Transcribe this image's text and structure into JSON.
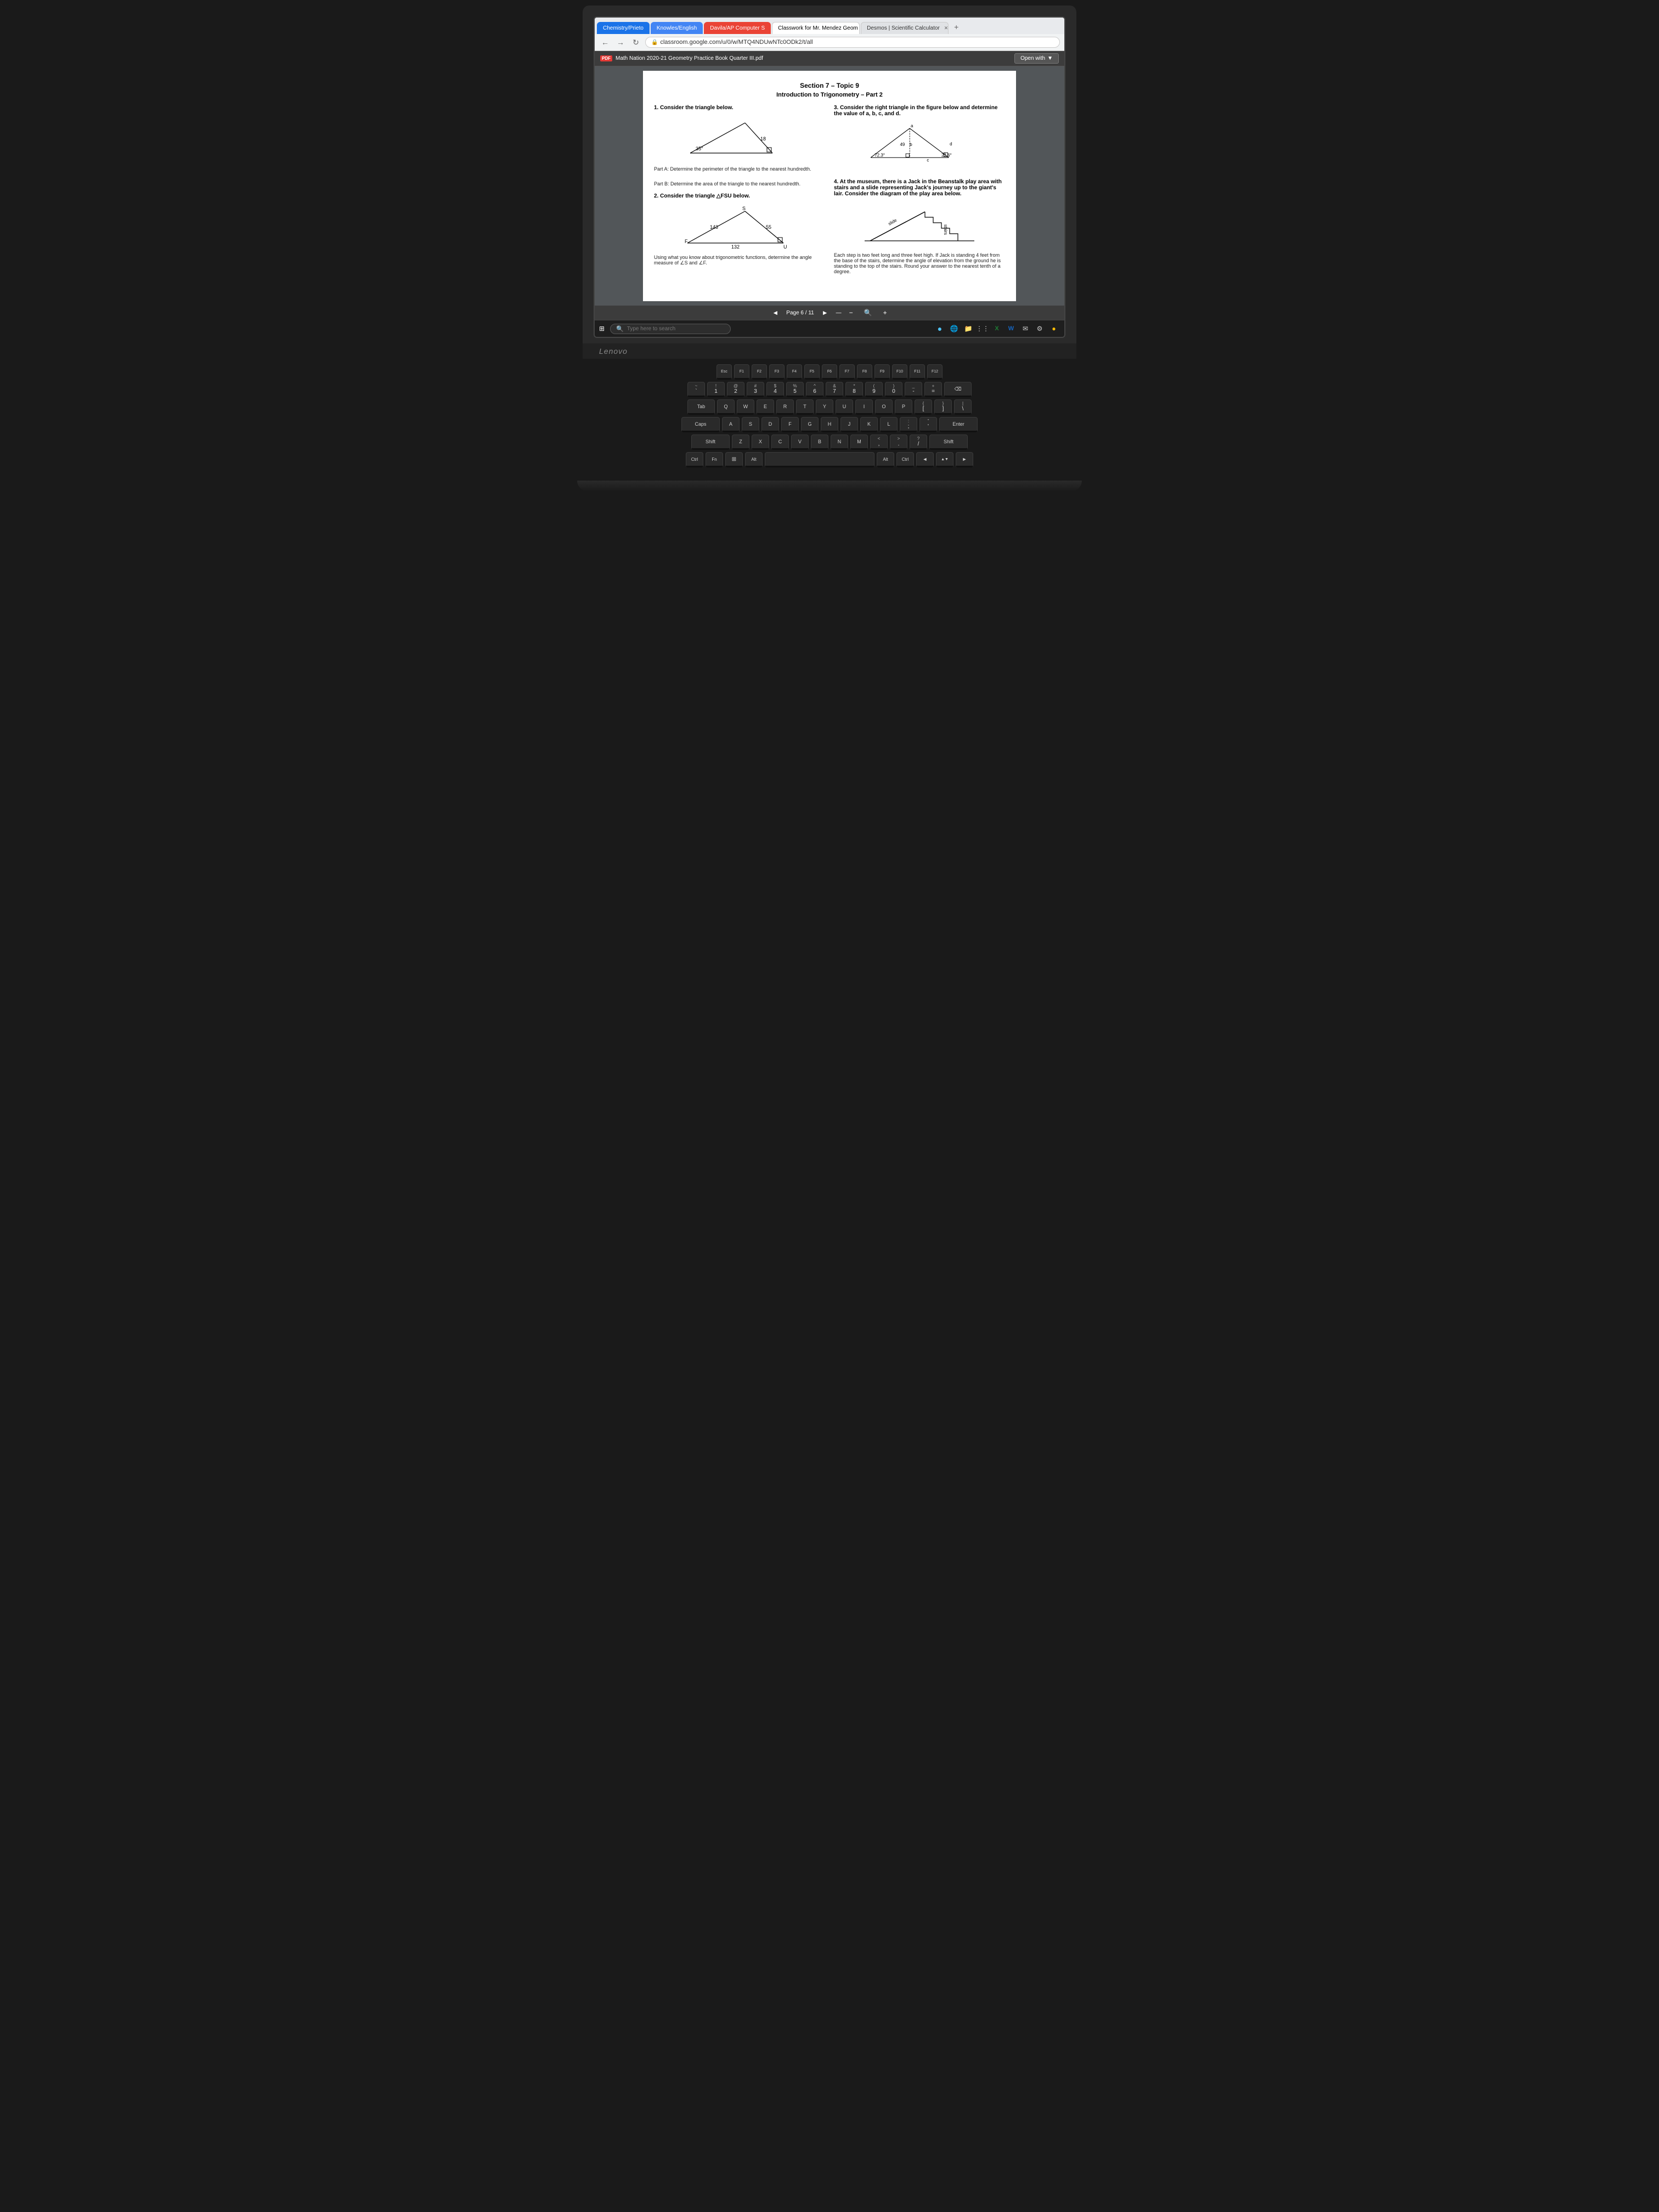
{
  "browser": {
    "tabs": [
      {
        "label": "Chemistry/Prieto",
        "style": "chemistry",
        "active": false
      },
      {
        "label": "Knowles/English",
        "style": "knowles",
        "active": false
      },
      {
        "label": "Davila/AP Computer S",
        "style": "davila",
        "active": false
      },
      {
        "label": "Classwork for Mr. Mendez Geom",
        "style": "active",
        "active": true
      },
      {
        "label": "Desmos | Scientific Calculator",
        "style": "",
        "active": false
      }
    ],
    "url": "classroom.google.com/u/0/w/MTQ4NDUwNTc0ODk2/t/all",
    "new_tab_label": "+"
  },
  "pdf": {
    "filename": "Math Nation 2020-21 Geometry Practice Book Quarter III.pdf",
    "open_with_label": "Open with",
    "section_title": "Section 7 – Topic 9",
    "section_subtitle": "Introduction to Trigonometry – Part 2",
    "problems": [
      {
        "number": "1.",
        "text": "Consider the triangle below.",
        "angle": "35°",
        "side": "18",
        "part_a": "Part A: Determine the perimeter of the triangle to the nearest hundredth.",
        "part_b": "Part B: Determine the area of the triangle to the nearest hundredth."
      },
      {
        "number": "3.",
        "text": "Consider the right triangle in the figure below and determine the value of a, b, c, and d.",
        "labels": [
          "a",
          "b",
          "c",
          "d",
          "49",
          "23.6°",
          "72.3°"
        ]
      },
      {
        "number": "2.",
        "text": "Consider the triangle △FSU below.",
        "labels": [
          "S",
          "F",
          "U",
          "143",
          "55",
          "132"
        ],
        "part": "Using what you know about trigonometric functions, determine the angle measure of ∠S and ∠F."
      },
      {
        "number": "4.",
        "text": "At the museum, there is a Jack in the Beanstalk play area with stairs and a slide representing Jack's journey up to the giant's lair. Consider the diagram of the play area below.",
        "description": "Each step is two feet long and three feet high. If Jack is standing 4 feet from the base of the stairs, determine the angle of elevation from the ground he is standing to the top of the stairs. Round your answer to the nearest tenth of a degree.",
        "labels": [
          "slide",
          "stairs"
        ]
      }
    ],
    "page_info": "Page 6 / 11",
    "zoom": "—"
  },
  "taskbar": {
    "search_placeholder": "Type here to search",
    "icons": [
      "⊞",
      "🔍",
      "●",
      "🌐",
      "📁",
      "📧",
      "X",
      "W",
      "✉",
      "⚙",
      "🌐"
    ]
  },
  "lenovo_label": "Lenovo",
  "keyboard": {
    "fn_row": [
      "Esc",
      "F1",
      "F2",
      "F3",
      "F4",
      "F5",
      "F6",
      "F7",
      "F8",
      "F9",
      "F10",
      "F11",
      "F12"
    ],
    "row1": [
      "`",
      "1",
      "2",
      "3",
      "4",
      "5",
      "6",
      "7",
      "8",
      "9",
      "0",
      "-",
      "=",
      "⌫"
    ],
    "row2": [
      "Tab",
      "Q",
      "W",
      "E",
      "R",
      "T",
      "Y",
      "U",
      "I",
      "O",
      "P",
      "[",
      "]",
      "\\"
    ],
    "row3": [
      "Caps",
      "A",
      "S",
      "D",
      "F",
      "G",
      "H",
      "J",
      "K",
      "L",
      ";",
      "'",
      "Enter"
    ],
    "row4": [
      "Shift",
      "Z",
      "X",
      "C",
      "V",
      "B",
      "N",
      "M",
      ",",
      ".",
      "/",
      "Shift"
    ],
    "row5": [
      "Ctrl",
      "Fn",
      "Win",
      "Alt",
      "Space",
      "Alt",
      "Ctrl",
      "◄",
      "▲▼",
      "►"
    ]
  }
}
